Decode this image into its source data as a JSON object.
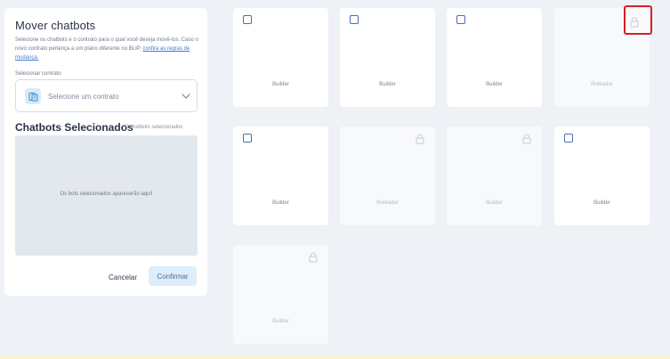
{
  "panel": {
    "title": "Mover chatbots",
    "description": "Selecione os chatbots e o contrato para o qual você deseja movê-los. Caso o novo contrato pertença a um plano diferente no BLIP,",
    "description_link": "confira as regras de mudança.",
    "contract_label": "Selecionar contrato",
    "contract_placeholder": "Selecione um contrato",
    "selected_title": "Chatbots Selecionados",
    "selected_count": "0 chatbots selecionados",
    "selected_empty": "Os bots selecionados aparecerão aqui!",
    "cancel_label": "Cancelar",
    "confirm_label": "Confirmar"
  },
  "cards": [
    {
      "label": "Builder",
      "locked": false
    },
    {
      "label": "Builder",
      "locked": false
    },
    {
      "label": "Builder",
      "locked": false
    },
    {
      "label": "Roteador",
      "locked": true
    },
    {
      "label": "Builder",
      "locked": false
    },
    {
      "label": "Roteador",
      "locked": true
    },
    {
      "label": "Builder",
      "locked": true
    },
    {
      "label": "Builder",
      "locked": false
    },
    {
      "label": "Builder",
      "locked": true
    }
  ],
  "colors": {
    "accent": "#3f7ad6",
    "highlight": "#d6202a",
    "background": "#eef1f5"
  }
}
